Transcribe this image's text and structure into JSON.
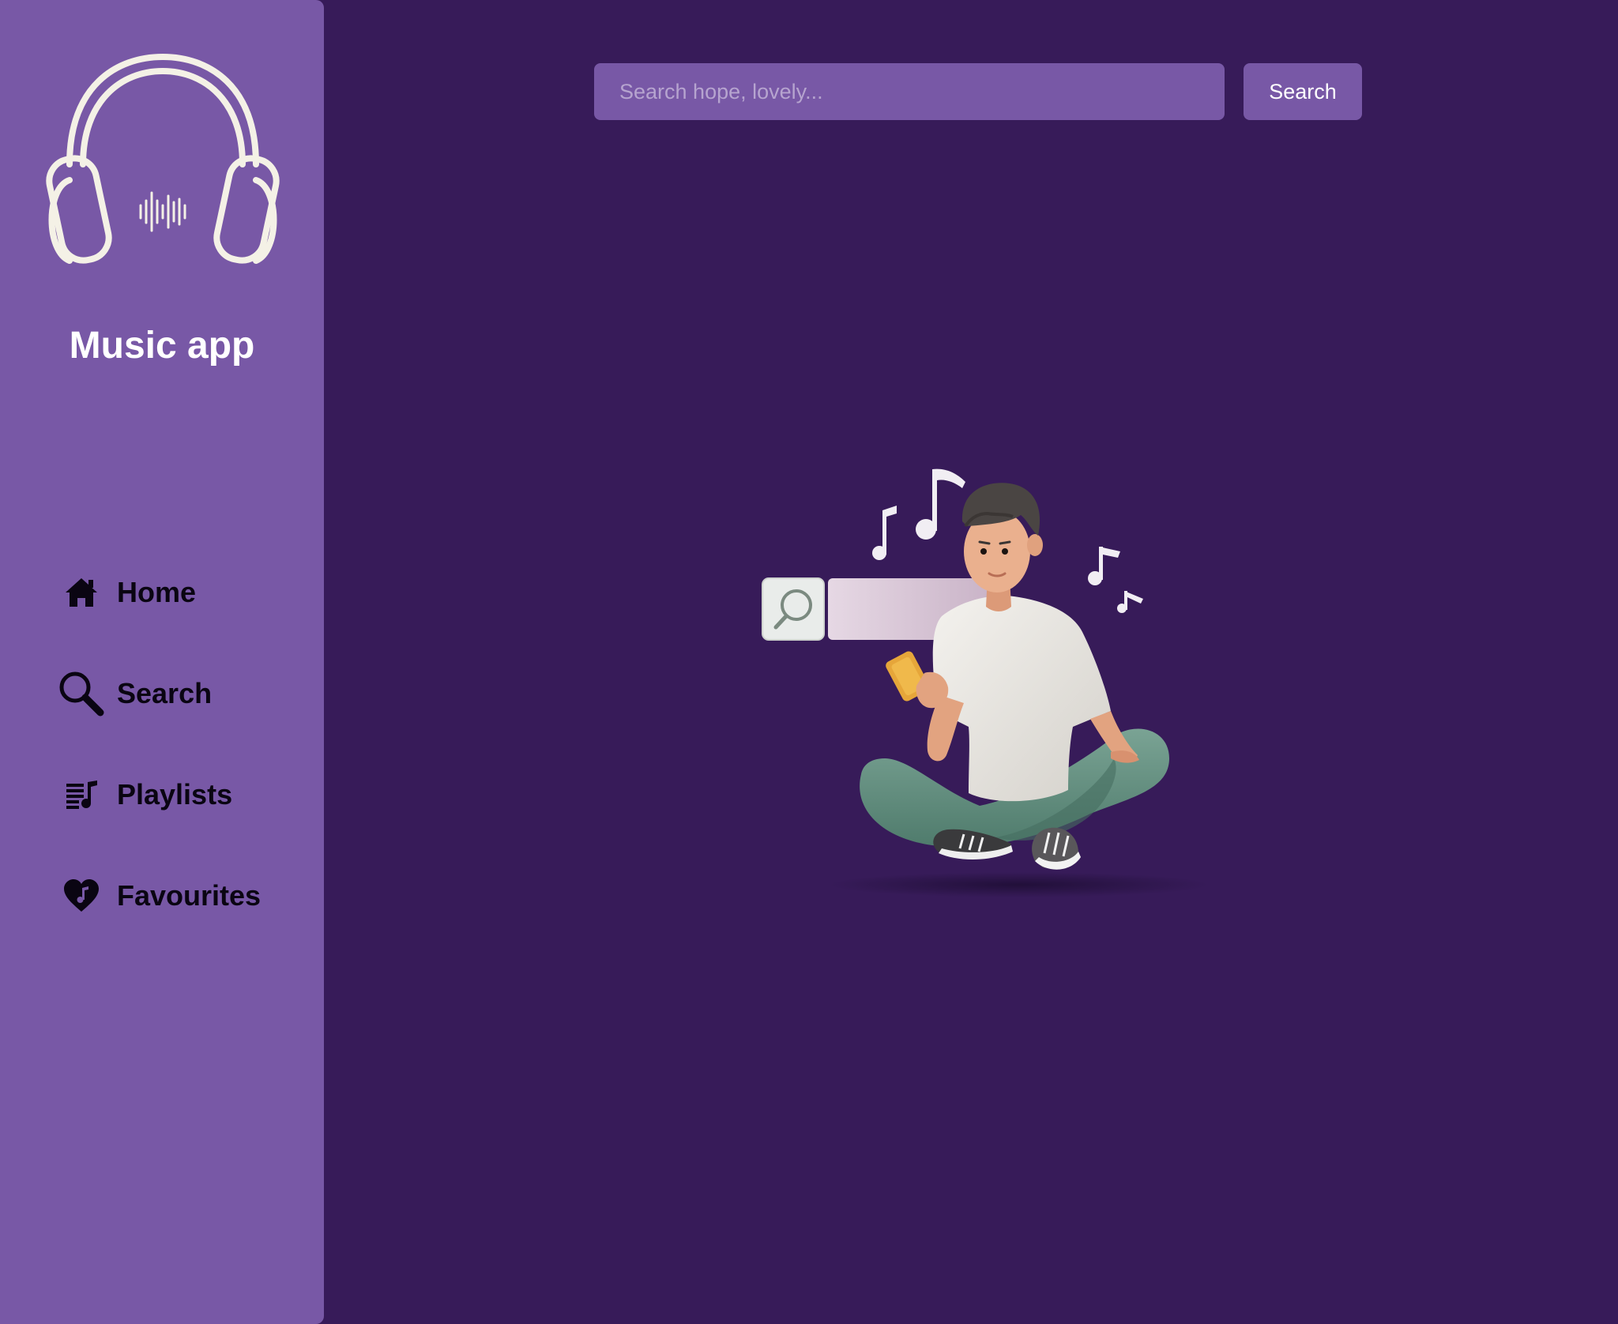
{
  "sidebar": {
    "app_title": "Music app",
    "logo_icon": "headphones-icon",
    "items": [
      {
        "label": "Home",
        "icon": "home-icon"
      },
      {
        "label": "Search",
        "icon": "search-icon"
      },
      {
        "label": "Playlists",
        "icon": "playlist-icon"
      },
      {
        "label": "Favourites",
        "icon": "heart-music-icon"
      }
    ]
  },
  "search": {
    "placeholder": "Search hope, lovely...",
    "value": "",
    "button_label": "Search"
  },
  "colors": {
    "background": "#371b59",
    "sidebar": "#7858a6",
    "accent": "#7858a6",
    "text_light": "#ffffff",
    "nav_text": "#0a0512"
  }
}
